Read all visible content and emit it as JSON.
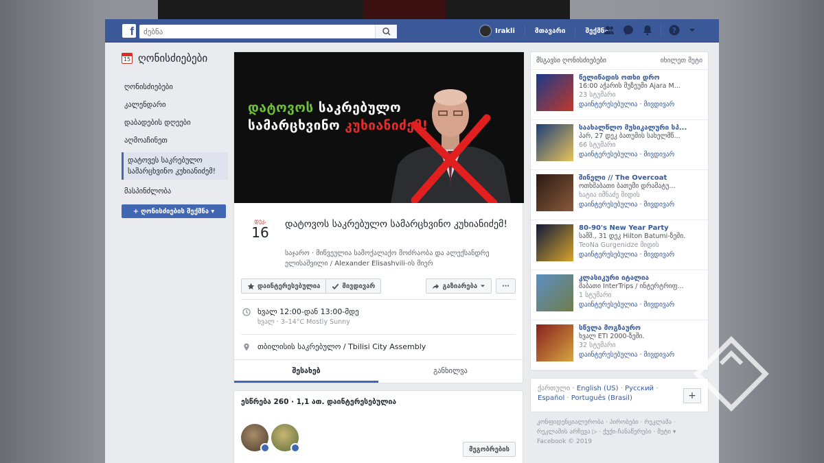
{
  "topbar": {
    "search_placeholder": "ძებნა",
    "user_name": "Irakli",
    "home_label": "მთავარი",
    "create_label": "შექმნა"
  },
  "leftnav": {
    "title": "ღონისძიებები",
    "calendar_day": "15",
    "items": [
      {
        "label": "ღონისძიებები"
      },
      {
        "label": "კალენდარი"
      },
      {
        "label": "დაბადების დღეები"
      },
      {
        "label": "აღმოაჩინეთ"
      },
      {
        "label": "დატოვეს საკრებულო სამარცხვინო კუხიანიძემ!"
      },
      {
        "label": "მასპინძლობა"
      }
    ],
    "create_button": "+ ღონისძიების შექმნა ▾"
  },
  "cover": {
    "line1_green": "დატოვოს",
    "line1_white": " საკრებულო",
    "line2_white": "სამარცხვინო ",
    "line2_red": "კუხიანიძემ!"
  },
  "event": {
    "month": "დეკ.",
    "day": "16",
    "title": "დატოვოს საკრებულო სამარცხვინო კუხიანიძემ!",
    "host_prefix": "საჯარო · მიწვეულია სამოქალაქო მოძრაობა და ალექსანდრე ელისაშვილი / ",
    "host_name": "Alexander Elisashvili",
    "host_suffix": "-ის მიერ",
    "interested_btn": "დაინტერესებულია",
    "going_btn": "მივდივარ",
    "share_btn": "გაზიარება",
    "more_btn": "···",
    "time_main": "ხვალ 12:00-დან 13:00-მდე",
    "time_sub": "ხვალ · 3–14°C Mostly Sunny",
    "location": "თბილისის საკრებულო / Tbilisi City Assembly",
    "tab_about": "შესახებ",
    "tab_discussion": "განხილვა",
    "guests_stat": "ესწრება 260 · 1,1 ათ. დაინტერესებულია",
    "invite_btn": "მეგობრების"
  },
  "sidebar": {
    "header": "მსგავსი ღონისძიებები",
    "see_more": "იხილეთ მეტი",
    "events": [
      {
        "title": "წელიწადის ოთხი დრო",
        "line1": "16:00 აჭარის მუზეუმი Ajara M...",
        "line2": "23 სტუმარი",
        "actions": "დაინტერესებულია · მივდივარ",
        "c1": "#1b3a8a",
        "c2": "#c0392b"
      },
      {
        "title": "საახალწლო მუსიკალური სპ...",
        "line1": "პარ, 27 დეკ ბათუმის სახელმწ...",
        "line2": "66 სტუმარი",
        "actions": "დაინტერესებულია · მივდივარ",
        "c1": "#1d3f78",
        "c2": "#e8c35a"
      },
      {
        "title": "შინელი // The Overcoat",
        "line1": "ოთხშაბათი ბათუმი დრამატუ...",
        "line2": "ხატია იმნაძე მიდის",
        "actions": "დაინტერესებულია · მივდივარ",
        "c1": "#2a1a14",
        "c2": "#8a5a3a"
      },
      {
        "title": "80-90's New Year Party",
        "line1": "სამშ., 31 დეკ Hilton Batumi-ზეში.",
        "line2": "TeoNa Gurgenidze მიდის",
        "actions": "დაინტერესებულია · მივდივარ",
        "c1": "#111a3a",
        "c2": "#d6a42b"
      },
      {
        "title": "კლასიკური იტალია",
        "line1": "შაბათი InterTrips / ინტერტრიფ...",
        "line2": "1 სტუმარი",
        "actions": "დაინტერესებულია · მივდივარ",
        "c1": "#5d8fc4",
        "c2": "#6e7d4a"
      },
      {
        "title": "სწვლა მოგზაურო",
        "line1": "ხვალ ETI 2000-ზეში.",
        "line2": "32 სტუმარი",
        "actions": "დაინტერესებულია · მივდივარ",
        "c1": "#8a1f1f",
        "c2": "#d4a640"
      }
    ],
    "lang_current": "ქართული",
    "langs": [
      "English (US)",
      "Русский",
      "Español",
      "Português (Brasil)"
    ],
    "footer_line1": "კონფიდენციალურობა · პირობები · რეკლამა ·",
    "footer_line2": "რეკლამის არჩევა ▷ · ქუქი-ჩანაწერები · მეტი ▾",
    "footer_line3": "Facebook © 2019"
  },
  "colors": {
    "fb_blue": "#3b5998",
    "link": "#365899",
    "green_text": "#6fbf3b",
    "red_text": "#e22d2d"
  }
}
